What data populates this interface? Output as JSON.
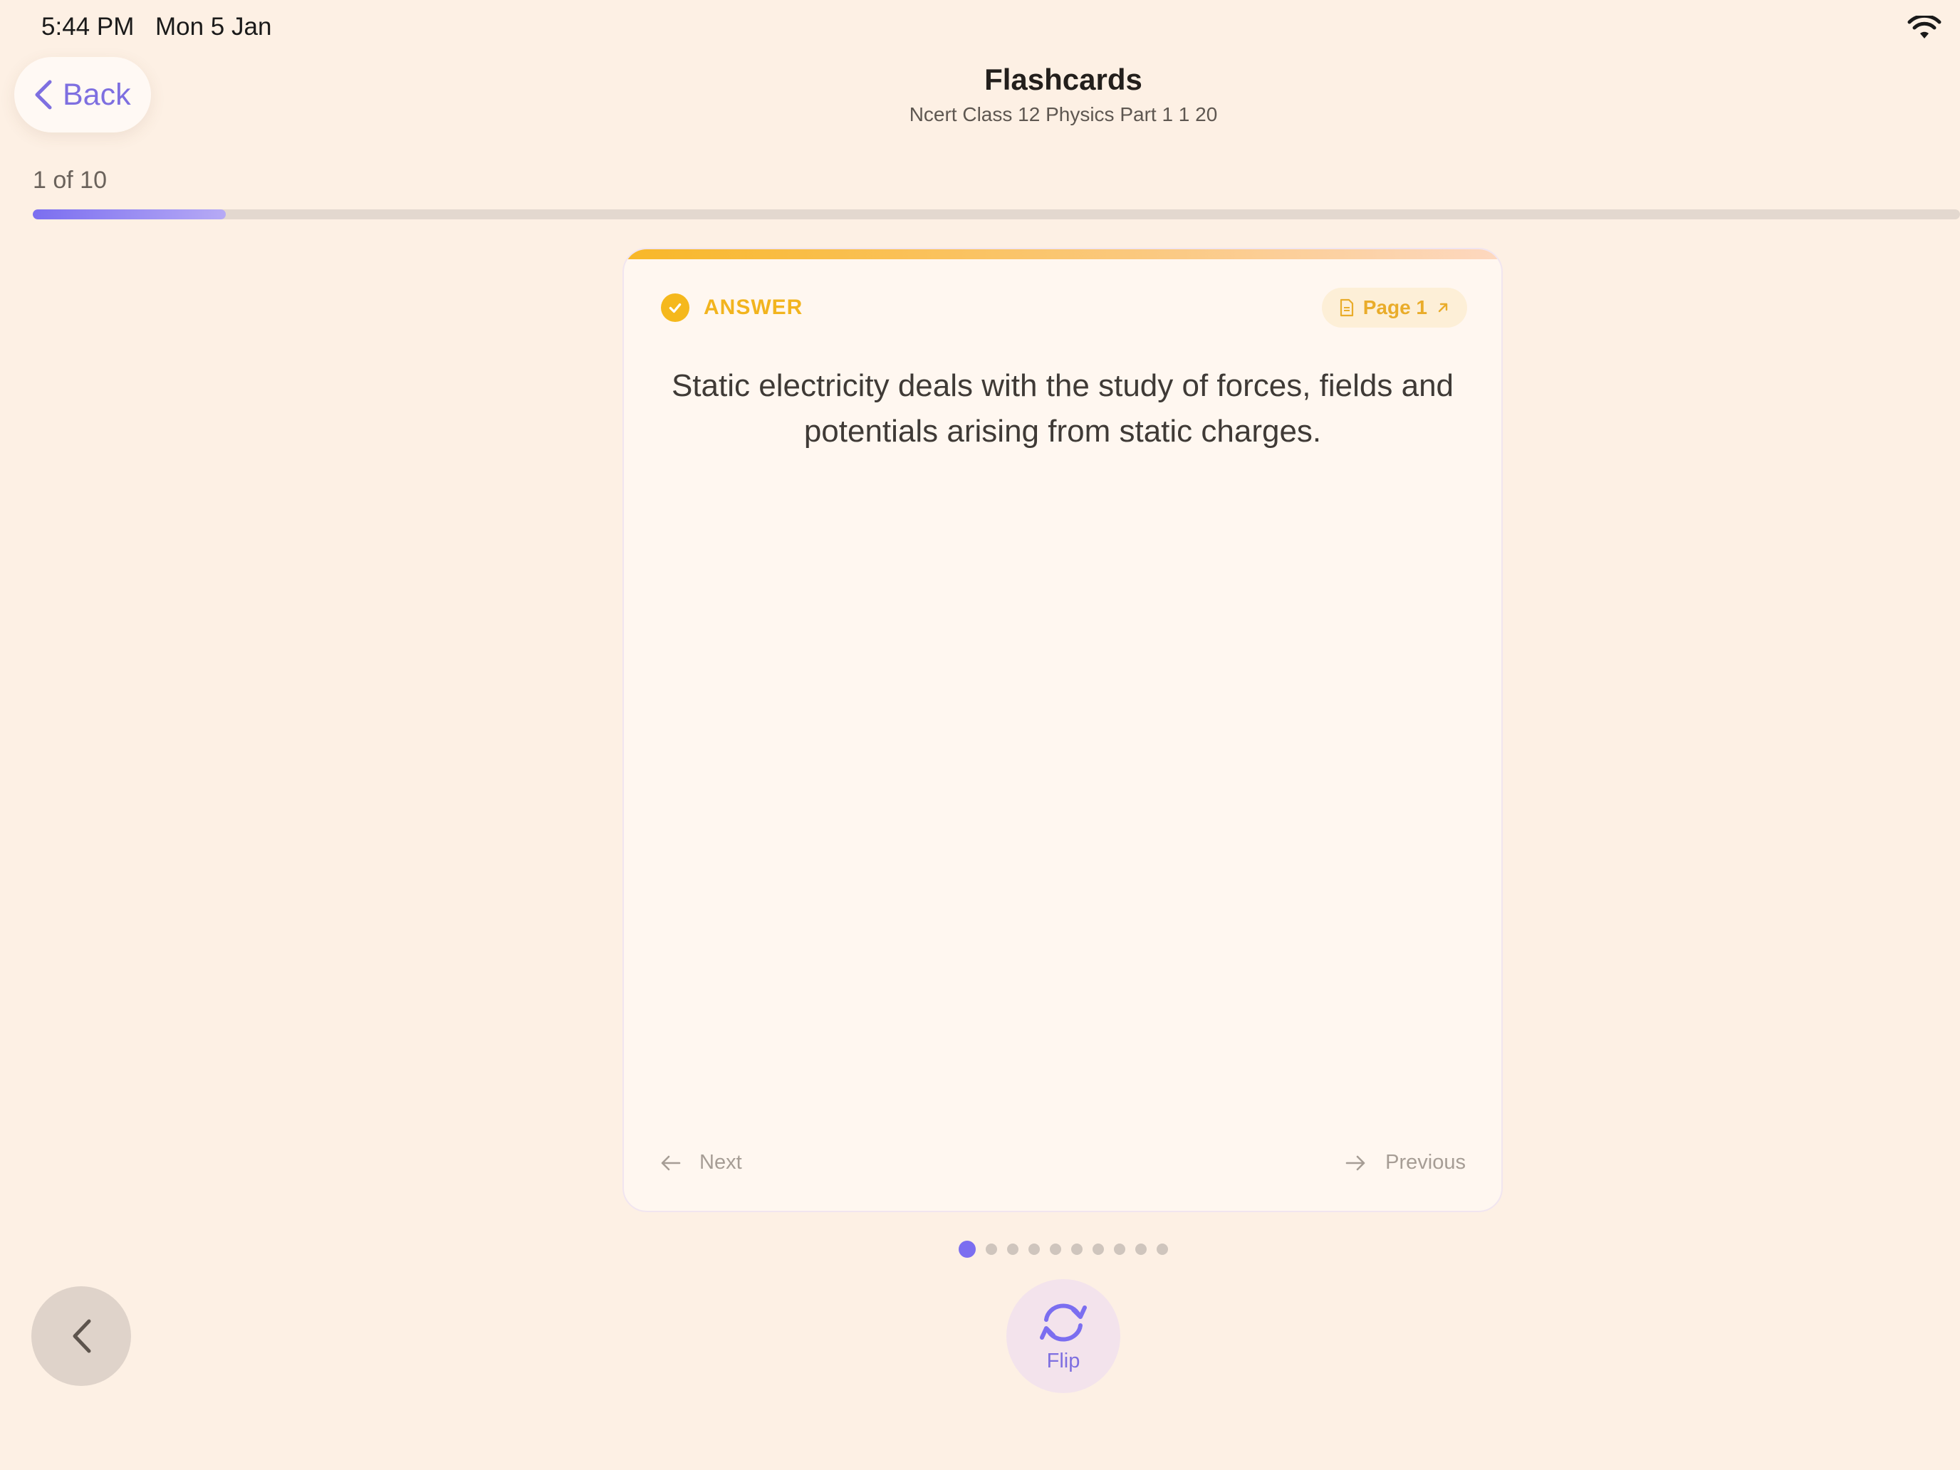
{
  "status_bar": {
    "time": "5:44 PM",
    "date": "Mon 5 Jan"
  },
  "header": {
    "back_label": "Back",
    "title": "Flashcards",
    "subtitle": "Ncert Class 12 Physics Part 1 1 20"
  },
  "progress": {
    "label": "1 of 10",
    "current": 1,
    "total": 10,
    "fraction": 0.1
  },
  "card": {
    "side_label": "ANSWER",
    "page_chip": "Page 1",
    "text": "Static electricity deals with the study of forces, fields and potentials arising from static charges.",
    "next_label": "Next",
    "previous_label": "Previous"
  },
  "pagination": {
    "count": 10,
    "active_index": 0
  },
  "controls": {
    "flip_label": "Flip"
  },
  "colors": {
    "background": "#fdf0e4",
    "accent": "#7b6ef0",
    "answer": "#f2b41e",
    "card": "#fff7f0"
  },
  "icons": [
    "wifi-icon",
    "chevron-left-icon",
    "check-icon",
    "document-icon",
    "external-arrow-icon",
    "arrow-left-icon",
    "arrow-right-icon",
    "refresh-icon"
  ]
}
